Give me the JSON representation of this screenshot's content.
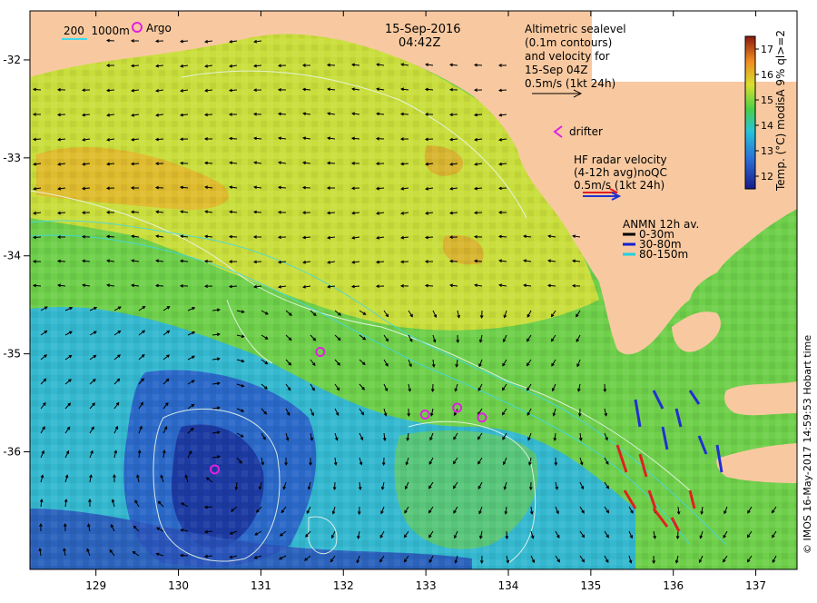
{
  "map": {
    "date": "15-Sep-2016",
    "time": "04:42Z",
    "credit": "© IMOS 16-May-2017 14:59:53 Hobart time",
    "lon_ticks": [
      "129",
      "130",
      "131",
      "132",
      "133",
      "134",
      "135",
      "136",
      "137"
    ],
    "lat_ticks": [
      "-32",
      "-33",
      "-34",
      "-35",
      "-36"
    ],
    "colors": {
      "land": "#f8c9a0",
      "warm": "#f0a020",
      "mid": "#7ad24a",
      "cool": "#2d9fd6",
      "cold": "#1f3fae"
    }
  },
  "legend": {
    "depth_label": "200  1000m",
    "argo_label": "Argo",
    "altimetric_lines": [
      "Altimetric sealevel",
      "(0.1m contours)",
      "and velocity for",
      "15-Sep 04Z",
      "0.5m/s (1kt 24h)"
    ],
    "drifter_label": "drifter",
    "hf_lines": [
      "HF radar velocity",
      "(4-12h avg)noQC",
      "0.5m/s (1kt 24h)"
    ],
    "anmn_title": "ANMN 12h av.",
    "anmn_items": [
      {
        "label": "0-30m",
        "color": "#000000"
      },
      {
        "label": "30-80m",
        "color": "#1020d0"
      },
      {
        "label": "80-150m",
        "color": "#20d0e0"
      }
    ]
  },
  "colorbar": {
    "ticks": [
      "17",
      "16",
      "15",
      "14",
      "13",
      "12"
    ],
    "label": "Temp. (°C) modisA 9% ql>=2",
    "vmin": 11.5,
    "vmax": 17.5
  },
  "argo_floats": [
    {
      "lon": 131.72,
      "lat": -34.98
    },
    {
      "lon": 130.44,
      "lat": -36.18
    },
    {
      "lon": 132.99,
      "lat": -35.62
    },
    {
      "lon": 133.38,
      "lat": -35.55
    },
    {
      "lon": 133.68,
      "lat": -35.65
    }
  ]
}
